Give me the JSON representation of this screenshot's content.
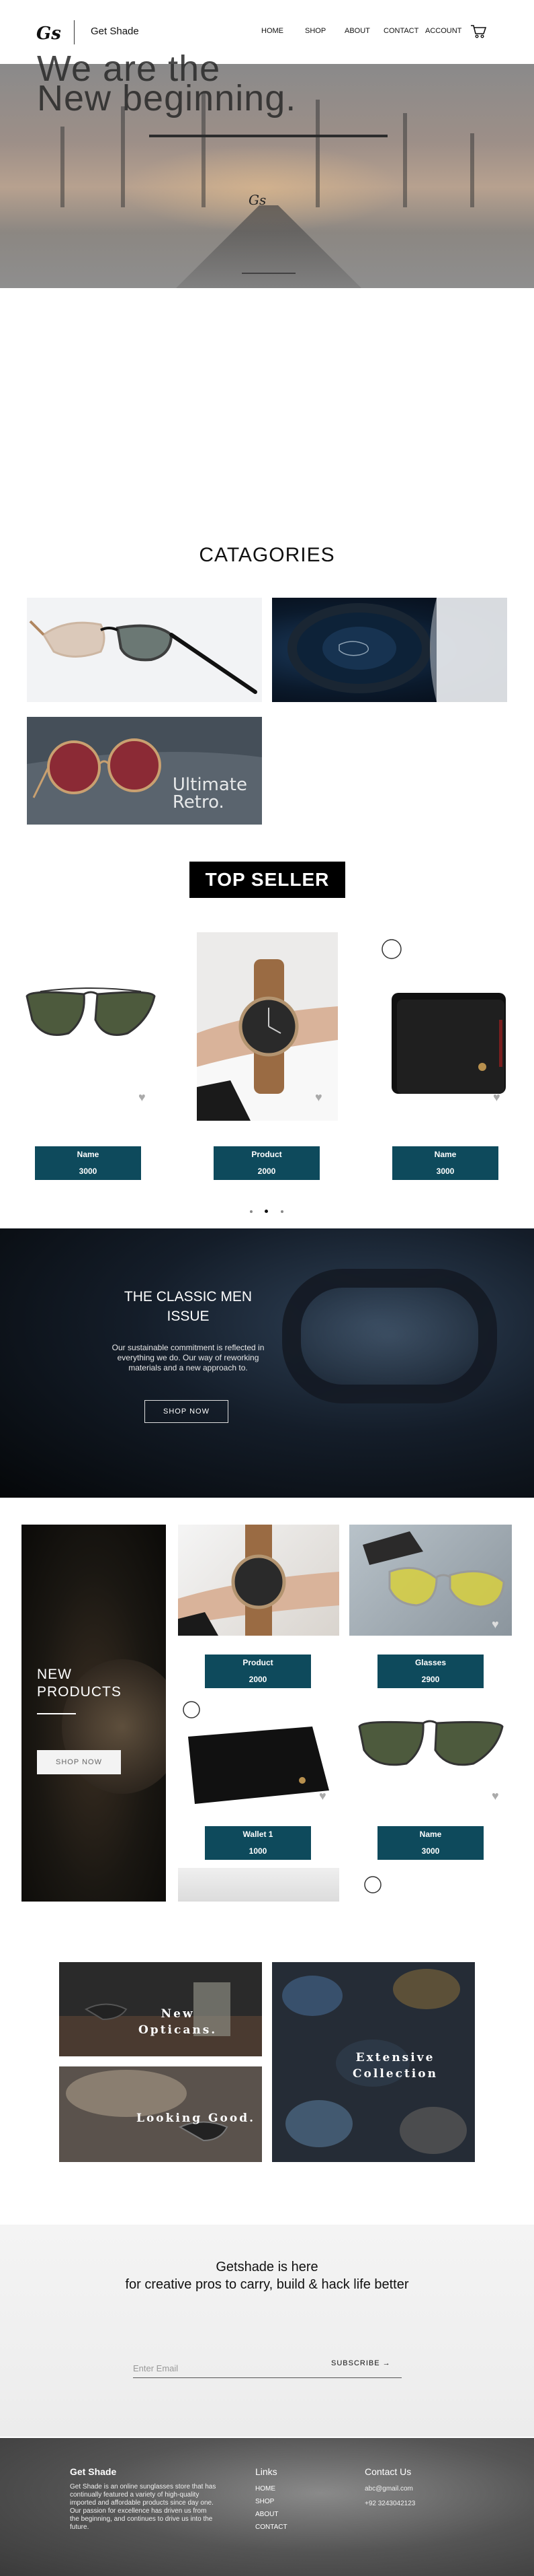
{
  "header": {
    "logo_text": "Gs",
    "brand": "Get Shade",
    "nav": [
      "HOME",
      "SHOP",
      "ABOUT",
      "CONTACT",
      "ACCOUNT"
    ]
  },
  "hero": {
    "title_line1": "We are the",
    "title_line2": "New beginning.",
    "signature": "Gs"
  },
  "categories": {
    "title": "CATAGORIES",
    "card3_text_line1": "Ultimate",
    "card3_text_line2": "Retro."
  },
  "top_seller": {
    "title": "TOP SELLER",
    "products": [
      {
        "name": "Name",
        "price": "3000"
      },
      {
        "name": "Product",
        "price": "2000"
      },
      {
        "name": "Name",
        "price": "3000"
      }
    ]
  },
  "classic": {
    "title": "THE CLASSIC MEN ISSUE",
    "description": "Our sustainable commitment is reflected in everything we do. Our way of reworking materials and a new approach to.",
    "button": "SHOP NOW"
  },
  "new_products": {
    "title_line1": "NEW",
    "title_line2": "PRODUCTS",
    "button": "SHOP NOW",
    "products": [
      {
        "name": "Product",
        "price": "2000"
      },
      {
        "name": "Glasses",
        "price": "2900"
      },
      {
        "name": "Wallet 1",
        "price": "1000"
      },
      {
        "name": "Name",
        "price": "3000"
      }
    ]
  },
  "gallery": {
    "g1_line1": "New",
    "g1_line2": "Opticans.",
    "g2": "Looking Good.",
    "g3_line1": "Extensive",
    "g3_line2": "Collection"
  },
  "newsletter": {
    "title_line1": "Getshade is here",
    "title_line2": "for creative pros to carry, build & hack life better",
    "placeholder": "Enter Email",
    "button": "SUBSCRIBE →"
  },
  "footer": {
    "brand": "Get Shade",
    "about": "Get Shade is an online sunglasses store that has continually featured a variety of high-quality imported and affordable products since day one. Our passion for excellence has driven us from the beginning, and continues to drive us into the future.",
    "links_title": "Links",
    "links": [
      "HOME",
      "SHOP",
      "ABOUT",
      "CONTACT"
    ],
    "contact_title": "Contact Us",
    "email": "abc@gmail.com",
    "phone": "+92 3243042123"
  },
  "colors": {
    "accent_teal": "#0e4a5c",
    "black": "#000000"
  }
}
